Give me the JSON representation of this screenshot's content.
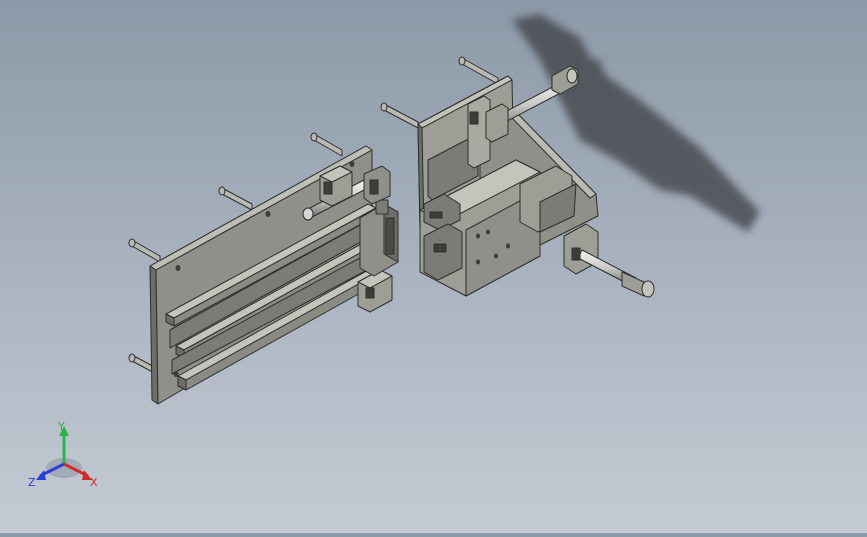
{
  "viewport": {
    "background_top": "#8d99a8",
    "background_bottom": "#c4cbd4",
    "model_face": "#9b9c93",
    "model_face_dark": "#6d6e67",
    "model_edge": "#2e2f2c",
    "shaft_color": "#d7d7d5",
    "shadow_color": "#3c3f44"
  },
  "triad": {
    "x_label": "X",
    "y_label": "Y",
    "z_label": "Z",
    "x_color": "#d42a2a",
    "y_color": "#2ab34a",
    "z_color": "#2a3fd4"
  }
}
